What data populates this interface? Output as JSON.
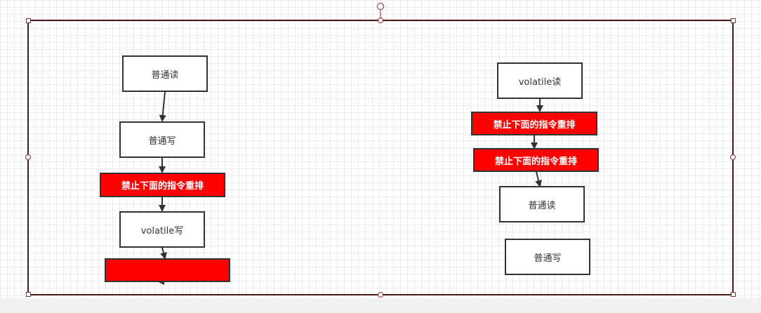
{
  "diagram": {
    "left_column": {
      "normal_read": "普通读",
      "normal_write": "普通写",
      "barrier": "禁止下面的指令重排",
      "volatile_write": "volatile写",
      "barrier_blank": ""
    },
    "right_column": {
      "volatile_read": "volatile读",
      "barrier_1": "禁止下面的指令重排",
      "barrier_2": "禁止下面的指令重排",
      "normal_read": "普通读",
      "normal_write": "普通写"
    }
  },
  "colors": {
    "barrier_fill": "#ff0000",
    "node_border": "#333333",
    "arrow": "#333333",
    "selection_border": "#4a1a1a",
    "handle_border": "#8a2a2a"
  }
}
